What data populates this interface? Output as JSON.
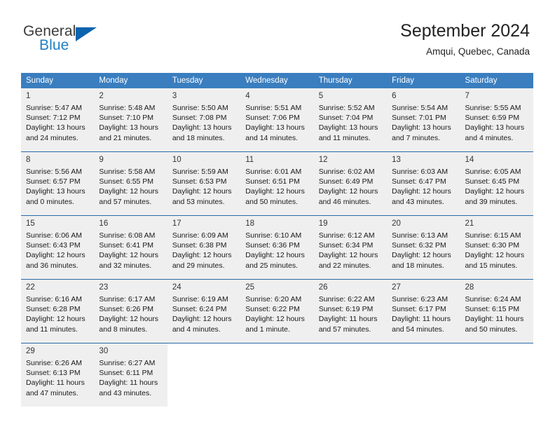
{
  "brand": {
    "name_part1": "General",
    "name_part2": "Blue",
    "flag_icon": "blue-triangle-logo-icon"
  },
  "header": {
    "title": "September 2024",
    "location": "Amqui, Quebec, Canada"
  },
  "colors": {
    "header_blue": "#3a7ebf",
    "row_divider_blue": "#2a6aa8",
    "cell_gray": "#efefef",
    "brand_blue": "#1f7fc4",
    "logo_blue": "#0b64ae"
  },
  "weekday_headers": [
    "Sunday",
    "Monday",
    "Tuesday",
    "Wednesday",
    "Thursday",
    "Friday",
    "Saturday"
  ],
  "weeks": [
    [
      {
        "day": "1",
        "sunrise": "Sunrise: 5:47 AM",
        "sunset": "Sunset: 7:12 PM",
        "daylight_line1": "Daylight: 13 hours",
        "daylight_line2": "and 24 minutes."
      },
      {
        "day": "2",
        "sunrise": "Sunrise: 5:48 AM",
        "sunset": "Sunset: 7:10 PM",
        "daylight_line1": "Daylight: 13 hours",
        "daylight_line2": "and 21 minutes."
      },
      {
        "day": "3",
        "sunrise": "Sunrise: 5:50 AM",
        "sunset": "Sunset: 7:08 PM",
        "daylight_line1": "Daylight: 13 hours",
        "daylight_line2": "and 18 minutes."
      },
      {
        "day": "4",
        "sunrise": "Sunrise: 5:51 AM",
        "sunset": "Sunset: 7:06 PM",
        "daylight_line1": "Daylight: 13 hours",
        "daylight_line2": "and 14 minutes."
      },
      {
        "day": "5",
        "sunrise": "Sunrise: 5:52 AM",
        "sunset": "Sunset: 7:04 PM",
        "daylight_line1": "Daylight: 13 hours",
        "daylight_line2": "and 11 minutes."
      },
      {
        "day": "6",
        "sunrise": "Sunrise: 5:54 AM",
        "sunset": "Sunset: 7:01 PM",
        "daylight_line1": "Daylight: 13 hours",
        "daylight_line2": "and 7 minutes."
      },
      {
        "day": "7",
        "sunrise": "Sunrise: 5:55 AM",
        "sunset": "Sunset: 6:59 PM",
        "daylight_line1": "Daylight: 13 hours",
        "daylight_line2": "and 4 minutes."
      }
    ],
    [
      {
        "day": "8",
        "sunrise": "Sunrise: 5:56 AM",
        "sunset": "Sunset: 6:57 PM",
        "daylight_line1": "Daylight: 13 hours",
        "daylight_line2": "and 0 minutes."
      },
      {
        "day": "9",
        "sunrise": "Sunrise: 5:58 AM",
        "sunset": "Sunset: 6:55 PM",
        "daylight_line1": "Daylight: 12 hours",
        "daylight_line2": "and 57 minutes."
      },
      {
        "day": "10",
        "sunrise": "Sunrise: 5:59 AM",
        "sunset": "Sunset: 6:53 PM",
        "daylight_line1": "Daylight: 12 hours",
        "daylight_line2": "and 53 minutes."
      },
      {
        "day": "11",
        "sunrise": "Sunrise: 6:01 AM",
        "sunset": "Sunset: 6:51 PM",
        "daylight_line1": "Daylight: 12 hours",
        "daylight_line2": "and 50 minutes."
      },
      {
        "day": "12",
        "sunrise": "Sunrise: 6:02 AM",
        "sunset": "Sunset: 6:49 PM",
        "daylight_line1": "Daylight: 12 hours",
        "daylight_line2": "and 46 minutes."
      },
      {
        "day": "13",
        "sunrise": "Sunrise: 6:03 AM",
        "sunset": "Sunset: 6:47 PM",
        "daylight_line1": "Daylight: 12 hours",
        "daylight_line2": "and 43 minutes."
      },
      {
        "day": "14",
        "sunrise": "Sunrise: 6:05 AM",
        "sunset": "Sunset: 6:45 PM",
        "daylight_line1": "Daylight: 12 hours",
        "daylight_line2": "and 39 minutes."
      }
    ],
    [
      {
        "day": "15",
        "sunrise": "Sunrise: 6:06 AM",
        "sunset": "Sunset: 6:43 PM",
        "daylight_line1": "Daylight: 12 hours",
        "daylight_line2": "and 36 minutes."
      },
      {
        "day": "16",
        "sunrise": "Sunrise: 6:08 AM",
        "sunset": "Sunset: 6:41 PM",
        "daylight_line1": "Daylight: 12 hours",
        "daylight_line2": "and 32 minutes."
      },
      {
        "day": "17",
        "sunrise": "Sunrise: 6:09 AM",
        "sunset": "Sunset: 6:38 PM",
        "daylight_line1": "Daylight: 12 hours",
        "daylight_line2": "and 29 minutes."
      },
      {
        "day": "18",
        "sunrise": "Sunrise: 6:10 AM",
        "sunset": "Sunset: 6:36 PM",
        "daylight_line1": "Daylight: 12 hours",
        "daylight_line2": "and 25 minutes."
      },
      {
        "day": "19",
        "sunrise": "Sunrise: 6:12 AM",
        "sunset": "Sunset: 6:34 PM",
        "daylight_line1": "Daylight: 12 hours",
        "daylight_line2": "and 22 minutes."
      },
      {
        "day": "20",
        "sunrise": "Sunrise: 6:13 AM",
        "sunset": "Sunset: 6:32 PM",
        "daylight_line1": "Daylight: 12 hours",
        "daylight_line2": "and 18 minutes."
      },
      {
        "day": "21",
        "sunrise": "Sunrise: 6:15 AM",
        "sunset": "Sunset: 6:30 PM",
        "daylight_line1": "Daylight: 12 hours",
        "daylight_line2": "and 15 minutes."
      }
    ],
    [
      {
        "day": "22",
        "sunrise": "Sunrise: 6:16 AM",
        "sunset": "Sunset: 6:28 PM",
        "daylight_line1": "Daylight: 12 hours",
        "daylight_line2": "and 11 minutes."
      },
      {
        "day": "23",
        "sunrise": "Sunrise: 6:17 AM",
        "sunset": "Sunset: 6:26 PM",
        "daylight_line1": "Daylight: 12 hours",
        "daylight_line2": "and 8 minutes."
      },
      {
        "day": "24",
        "sunrise": "Sunrise: 6:19 AM",
        "sunset": "Sunset: 6:24 PM",
        "daylight_line1": "Daylight: 12 hours",
        "daylight_line2": "and 4 minutes."
      },
      {
        "day": "25",
        "sunrise": "Sunrise: 6:20 AM",
        "sunset": "Sunset: 6:22 PM",
        "daylight_line1": "Daylight: 12 hours",
        "daylight_line2": "and 1 minute."
      },
      {
        "day": "26",
        "sunrise": "Sunrise: 6:22 AM",
        "sunset": "Sunset: 6:19 PM",
        "daylight_line1": "Daylight: 11 hours",
        "daylight_line2": "and 57 minutes."
      },
      {
        "day": "27",
        "sunrise": "Sunrise: 6:23 AM",
        "sunset": "Sunset: 6:17 PM",
        "daylight_line1": "Daylight: 11 hours",
        "daylight_line2": "and 54 minutes."
      },
      {
        "day": "28",
        "sunrise": "Sunrise: 6:24 AM",
        "sunset": "Sunset: 6:15 PM",
        "daylight_line1": "Daylight: 11 hours",
        "daylight_line2": "and 50 minutes."
      }
    ],
    [
      {
        "day": "29",
        "sunrise": "Sunrise: 6:26 AM",
        "sunset": "Sunset: 6:13 PM",
        "daylight_line1": "Daylight: 11 hours",
        "daylight_line2": "and 47 minutes."
      },
      {
        "day": "30",
        "sunrise": "Sunrise: 6:27 AM",
        "sunset": "Sunset: 6:11 PM",
        "daylight_line1": "Daylight: 11 hours",
        "daylight_line2": "and 43 minutes."
      },
      {
        "day": "",
        "sunrise": "",
        "sunset": "",
        "daylight_line1": "",
        "daylight_line2": ""
      },
      {
        "day": "",
        "sunrise": "",
        "sunset": "",
        "daylight_line1": "",
        "daylight_line2": ""
      },
      {
        "day": "",
        "sunrise": "",
        "sunset": "",
        "daylight_line1": "",
        "daylight_line2": ""
      },
      {
        "day": "",
        "sunrise": "",
        "sunset": "",
        "daylight_line1": "",
        "daylight_line2": ""
      },
      {
        "day": "",
        "sunrise": "",
        "sunset": "",
        "daylight_line1": "",
        "daylight_line2": ""
      }
    ]
  ]
}
